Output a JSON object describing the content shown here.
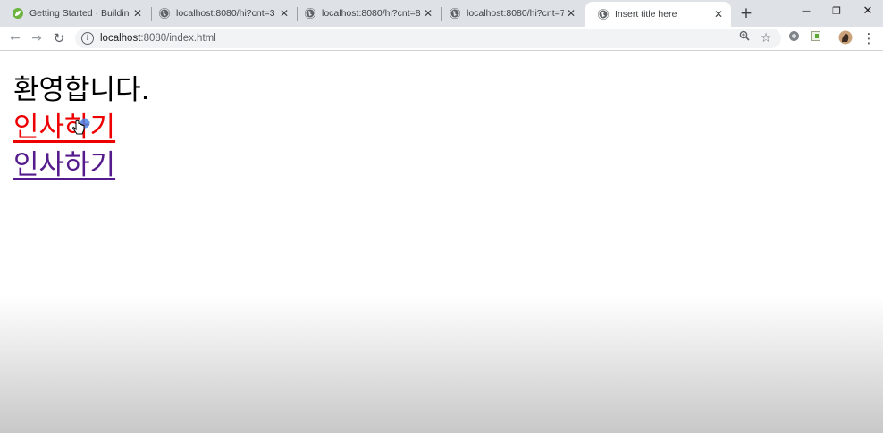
{
  "tabs": [
    {
      "title": "Getting Started · Building",
      "favicon": "spring-leaf-icon",
      "active": false
    },
    {
      "title": "localhost:8080/hi?cnt=3",
      "favicon": "globe-icon",
      "active": false
    },
    {
      "title": "localhost:8080/hi?cnt=8",
      "favicon": "globe-icon",
      "active": false
    },
    {
      "title": "localhost:8080/hi?cnt=7",
      "favicon": "globe-icon",
      "active": false
    },
    {
      "title": "Insert title here",
      "favicon": "globe-icon",
      "active": true
    }
  ],
  "tab_close_glyph": "✕",
  "new_tab_glyph": "+",
  "window_controls": {
    "minimize": "—",
    "restore": "❐",
    "close": "✕"
  },
  "toolbar": {
    "back_glyph": "←",
    "forward_glyph": "→",
    "reload_glyph": "↻",
    "address_host": "localhost",
    "address_rest": ":8080/index.html",
    "zoom_glyph": "⊕",
    "star_glyph": "☆",
    "menu_glyph": "⋮"
  },
  "page": {
    "heading": "환영합니다.",
    "links": [
      {
        "label": "인사하기",
        "state": "active"
      },
      {
        "label": "인사하기",
        "state": "visited"
      }
    ]
  },
  "colors": {
    "tabstrip_bg": "#dee1e6",
    "link_active": "#ee0000",
    "link_visited": "#551a8b",
    "spring_green": "#6db33f"
  }
}
